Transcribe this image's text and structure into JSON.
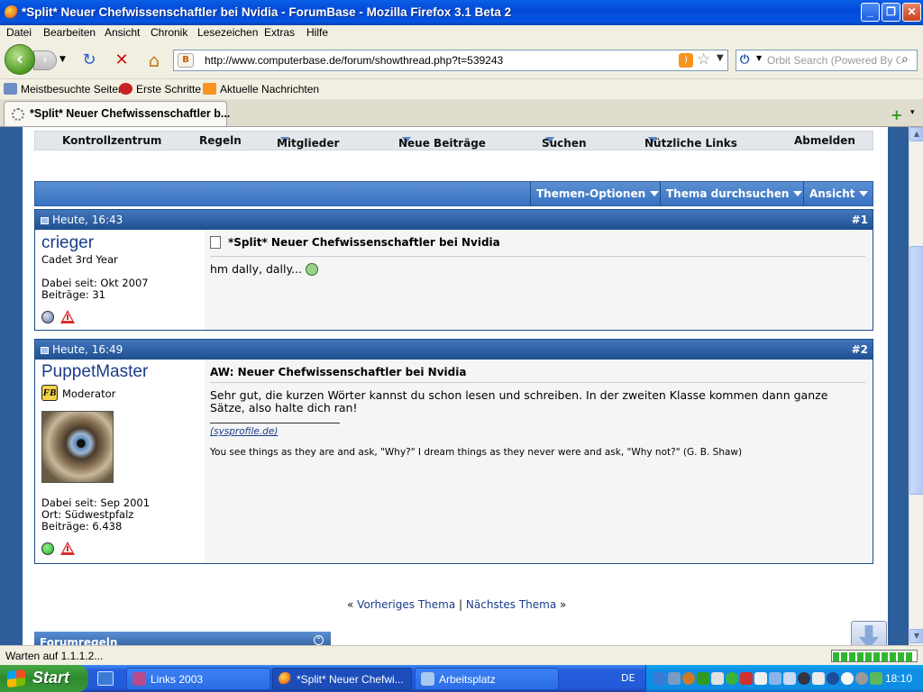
{
  "window": {
    "title": "*Split* Neuer Chefwissenschaftler bei Nvidia - ForumBase - Mozilla Firefox 3.1 Beta 2",
    "minimize": "_",
    "maximize": "❐",
    "close": "✕"
  },
  "menu": [
    "Datei",
    "Bearbeiten",
    "Ansicht",
    "Chronik",
    "Lesezeichen",
    "Extras",
    "Hilfe"
  ],
  "nav": {
    "back": "‹",
    "forward": "›",
    "reload": "↻",
    "stop": "✕",
    "home": "⌂",
    "url": "http://www.computerbase.de/forum/showthread.php?t=539243",
    "site_badge": "B",
    "search_placeholder": "Orbit Search (Powered By Google)"
  },
  "bookmarks": [
    "Meistbesuchte Seiten",
    "Erste Schritte",
    "Aktuelle Nachrichten"
  ],
  "tab": {
    "title": "*Split* Neuer Chefwissenschaftler b...",
    "new_tab": "+",
    "list": "▾"
  },
  "forum_nav": [
    "Kontrollzentrum",
    "Regeln",
    "Mitglieder",
    "Neue Beiträge",
    "Suchen",
    "Nützliche Links",
    "Abmelden"
  ],
  "thread_tools": [
    "Themen-Optionen",
    "Thema durchsuchen",
    "Ansicht"
  ],
  "posts": [
    {
      "date": "Heute, 16:43",
      "number": "#1",
      "username": "crieger",
      "rank": "Cadet 3rd Year",
      "joined": "Dabei seit: Okt 2007",
      "posts": "Beiträge: 31",
      "title": "*Split* Neuer Chefwissenschaftler bei Nvidia",
      "body": "hm dally, dally...",
      "online_color": "#5A6E9C"
    },
    {
      "date": "Heute, 16:49",
      "number": "#2",
      "username": "PuppetMaster",
      "badge": "FB",
      "rank": "Moderator",
      "joined": "Dabei seit: Sep 2001",
      "location": "Ort: Südwestpfalz",
      "posts": "Beiträge: 6.438",
      "title": "AW: Neuer Chefwissenschaftler bei Nvidia",
      "body_line1": "Sehr gut, die kurzen Wörter kannst du schon lesen und schreiben. In der zweiten Klasse kommen dann ganze",
      "body_line2": "Sätze, also halte dich ran!",
      "sig_link": "(sysprofile.de)",
      "sig_quote": "You see things as they are and ask, \"Why?\" I dream things as they never were and ask, \"Why not?\" (G. B. Shaw)",
      "online_color": "#1FB51F"
    }
  ],
  "pager": {
    "prev_arrow": "«",
    "prev": "Vorheriges Thema",
    "sep": "|",
    "next": "Nächstes Thema",
    "next_arrow": "»"
  },
  "rules_header": "Forumregeln",
  "status": "Warten auf 1.1.1.2...",
  "taskbar": {
    "start": "Start",
    "items": [
      "Links 2003",
      "*Split* Neuer Chefwi...",
      "Arbeitsplatz"
    ],
    "lang": "DE",
    "clock": "18:10"
  }
}
